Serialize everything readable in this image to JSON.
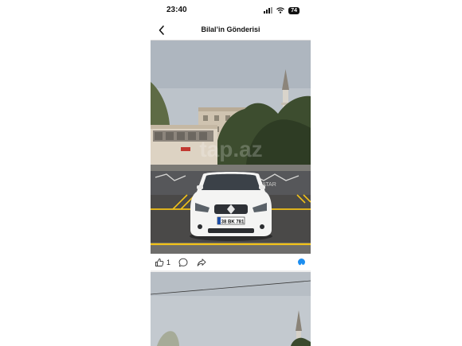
{
  "status_bar": {
    "time": "23:40",
    "battery": "74"
  },
  "header": {
    "title": "Bilal’in Gönderisi"
  },
  "post": {
    "plate_text": "38 BK 781",
    "watermark": "tap.az",
    "like_count": "1",
    "icons": {
      "back": "chevron-left-icon",
      "like": "thumbs-up-icon",
      "comment": "comment-bubble-icon",
      "share": "share-arrow-icon",
      "reaction": "like-reaction-icon"
    }
  },
  "colors": {
    "accent": "#1d8ef0",
    "sky": "#b9c1c9",
    "wall": "#dcd2c2",
    "asphalt": "#4c4b4a",
    "parking_line": "#f2c218",
    "car": "#f4f4f3"
  }
}
